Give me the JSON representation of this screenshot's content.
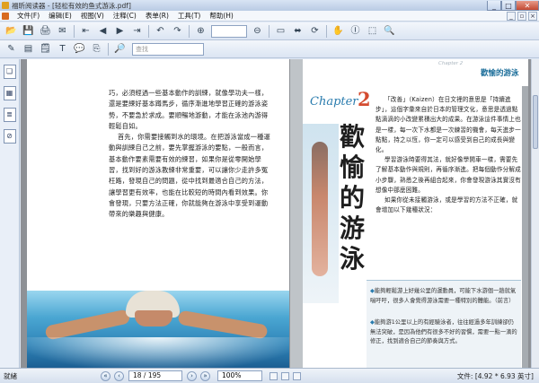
{
  "window": {
    "title": "福昕阅读器 - [轻松有效的鱼式游泳.pdf]",
    "min_label": "_",
    "max_label": "□",
    "close_label": "✕"
  },
  "menu": {
    "items": [
      "文件(F)",
      "编辑(E)",
      "视图(V)",
      "注释(C)",
      "表单(R)",
      "工具(T)",
      "帮助(H)"
    ]
  },
  "toolbar": {
    "zoom_value": "",
    "find_placeholder": "查找"
  },
  "left_page": {
    "paragraphs": [
      "巧，必須經過一些基本動作的訓練，就像學功夫一樣，還是要練好基本蹲馬步，循序漸進地學習正確的游泳姿勢，不要急於求成。要順暢地游動，才能在泳池內游得輕鬆自如。",
      "首先，你需要接觸到水的環境。在把游泳當成一種運動與訓練自己之前，要先掌握游泳的要點，一般而言，基本動作要素需要有效的練習，如果你是從零開始學習，找到好的游泳教練非常重要，可以讓你少走許多冤枉路，發現自己的問題，從中找到最適合自己的方法，讓學習更有效率，也能在比較短的時間內看到效果。你會發現，只要方法正確，你就能夠在游泳中享受到運動帶來的樂趣與健康。"
    ]
  },
  "right_page": {
    "header_small": "Chapter 2",
    "header_title": "歡愉的游泳",
    "chapter_label": "Chapter",
    "chapter_number": "2",
    "big_title": "歡愉的游泳",
    "paragraphs": [
      "「改善」（Kaizen）在日文裡的意思是「持續進步」，這個字彙來自於日本的管理文化，意思是透過點點滴滴的小改變累積出大的成果。在游泳這件事情上也是一樣，每一次下水都是一次練習的機會，每天進步一點點，持之以恆，你一定可以感受到自己的成長與變化。",
      "學習游泳時要得其法，就好像學開車一樣，需要先了解基本動作與規則，再循序漸進。把每個動作分解成小步驟，熟悉之後再組合起來，你會發現游泳其實沒有想像中那麼困難。",
      "如果你從未接觸游泳，或是學習的方法不正確，就會增加以下幾種狀況："
    ],
    "notes": [
      "能夠輕鬆游上好幾公里的運動員，可能下水游個一趟就氣喘吁吁，很多人會覺得游泳需要一種特別的體能。（前言）",
      "能夠游1公里以上的有經驗泳者，往往經過多年訓練卻仍無法突破，是因為他們有很多不好的習慣，需要一點一滴的修正，找到適合自己的節奏與方式。"
    ]
  },
  "status": {
    "left_text": "就緒",
    "page_display": "18 / 195",
    "zoom_display": "100%",
    "doc_size": "文件: [4.92 * 6.93 英寸]"
  }
}
